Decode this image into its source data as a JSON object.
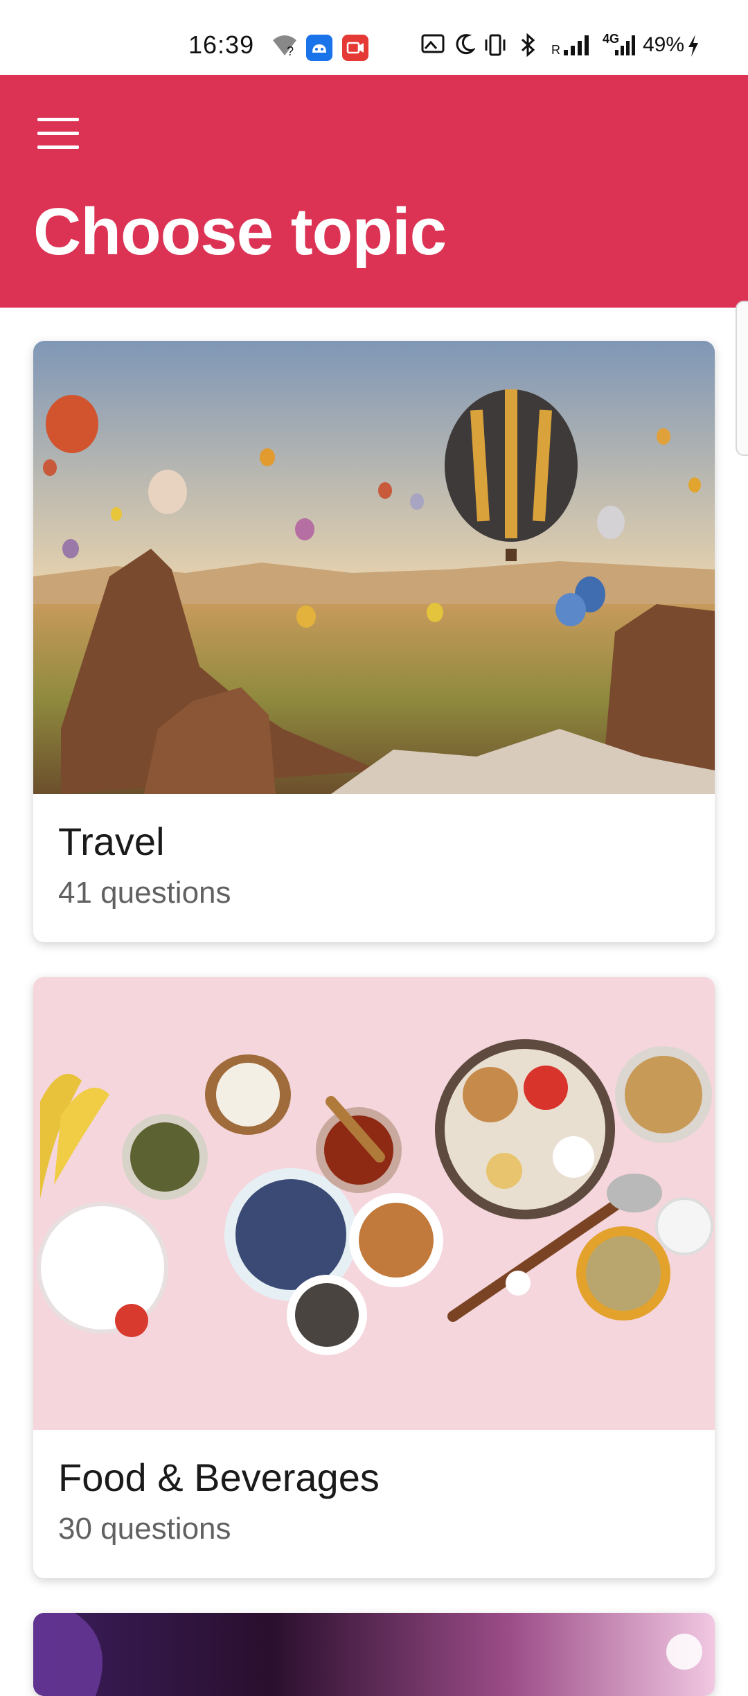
{
  "status_bar": {
    "time": "16:39",
    "battery": "49%",
    "network_label": "4G",
    "roaming_label": "R"
  },
  "header": {
    "title": "Choose topic"
  },
  "topics": [
    {
      "name": "Travel",
      "count": "41 questions"
    },
    {
      "name": "Food & Beverages",
      "count": "30 questions"
    }
  ],
  "colors": {
    "primary": "#dc3355",
    "background": "#ffffff"
  }
}
